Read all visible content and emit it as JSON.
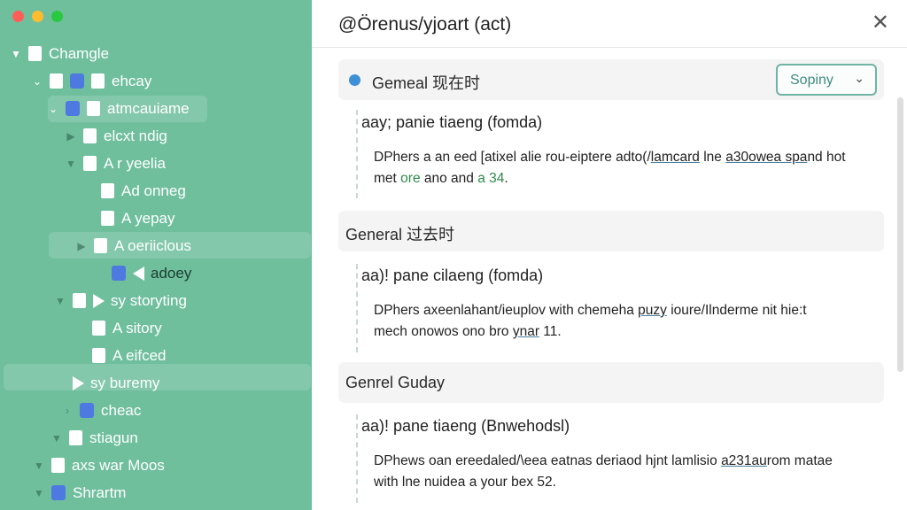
{
  "window": {
    "title": "@Örenus/yjoart (act)",
    "light_colors": [
      "#ff5f57",
      "#febc2e",
      "#28c840"
    ]
  },
  "sidebar": {
    "items": [
      {
        "label": "Chamgle",
        "level": 0
      },
      {
        "label": "ehcay",
        "level": 1
      },
      {
        "label": "atmcauiame",
        "level": 2,
        "selected": true
      },
      {
        "label": "elcxt ndig",
        "level": 3
      },
      {
        "label": "A r yeelia",
        "level": 3
      },
      {
        "label": "Ad onneg",
        "level": 4
      },
      {
        "label": "A yepay",
        "level": 4
      },
      {
        "label": "A oeriiclous",
        "level": 3,
        "selected": true
      },
      {
        "label": "adoey",
        "level": 4
      },
      {
        "label": "sy storyting",
        "level": 2
      },
      {
        "label": "A sitory",
        "level": 3
      },
      {
        "label": "A eifced",
        "level": 3
      },
      {
        "label": "sy buremy",
        "level": 2,
        "selected": true
      },
      {
        "label": "cheac",
        "level": 2
      },
      {
        "label": "stiagun",
        "level": 2
      },
      {
        "label": "axs war Moos",
        "level": 1
      },
      {
        "label": "Shrartm",
        "level": 1
      }
    ]
  },
  "main": {
    "section1": {
      "title": "Gemeal 现在时",
      "select_value": "Sopiny",
      "entry_head": "aay; panie tiaeng (fomda)",
      "body_line1_a": "DPhers a an eed [atixel alie rou-eiptere adto(/",
      "body_line1_link": "lamcard",
      "body_line1_b": " lne ",
      "body_line1_link2": "a30owea spa",
      "body_line1_c": "nd hot",
      "body_line2_a": "met ",
      "body_line2_green": "ore",
      "body_line2_b": " ano and ",
      "body_line2_green2": "a 34",
      "body_line2_c": "."
    },
    "section2": {
      "title": "General 过去时",
      "entry_head": "aa)! pane cilaeng (fomda)",
      "body_line1_a": "DPhers axeenlahant/ieuplov with chemeha ",
      "body_line1_link": "puzy",
      "body_line1_b": " ioure/Ilnderme nit hie:t",
      "body_line2_a": "mech onowos ono bro ",
      "body_line2_link": "ynar",
      "body_line2_b": " 11."
    },
    "section3": {
      "title": "Genrel Guday",
      "entry_head": "aa)! pane tiaeng (Bnwehodsl)",
      "body_line1_a": "DPhews oan ereedaled/\\eea eatnas deriaod hjnt lamlisio ",
      "body_line1_link": "a231au",
      "body_line1_b": "rom matae",
      "body_line2_a": "with lne nuidea a your bex 52."
    }
  }
}
